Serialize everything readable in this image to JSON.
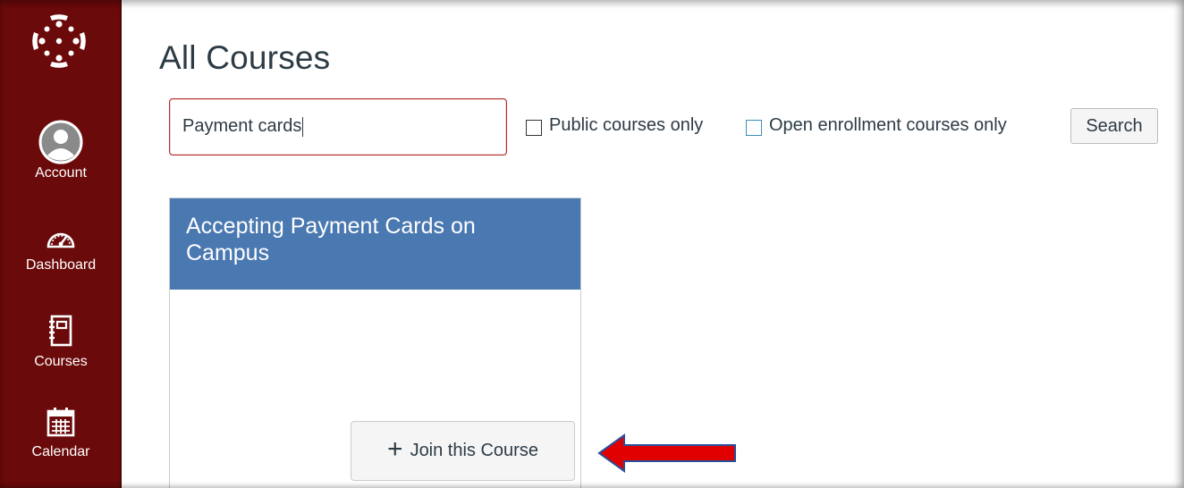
{
  "sidebar": {
    "items": [
      {
        "label": "Account",
        "icon": "user-avatar-icon"
      },
      {
        "label": "Dashboard",
        "icon": "speedometer-icon"
      },
      {
        "label": "Courses",
        "icon": "book-icon"
      },
      {
        "label": "Calendar",
        "icon": "calendar-icon"
      }
    ],
    "background": "#6b0a0a",
    "logo": "canvas-logo-icon"
  },
  "main": {
    "title": "All Courses",
    "search": {
      "value": "Payment cards",
      "button_label": "Search"
    },
    "filters": [
      {
        "label": "Public courses only",
        "checked": false
      },
      {
        "label": "Open enrollment courses only",
        "checked": false
      }
    ]
  },
  "course_card": {
    "title": "Accepting Payment Cards on Campus",
    "header_color": "#4a78b0",
    "join_label": "Join this Course",
    "join_icon": "plus-icon"
  },
  "annotation": {
    "arrow_color": "#e00000",
    "arrow_direction": "left"
  }
}
